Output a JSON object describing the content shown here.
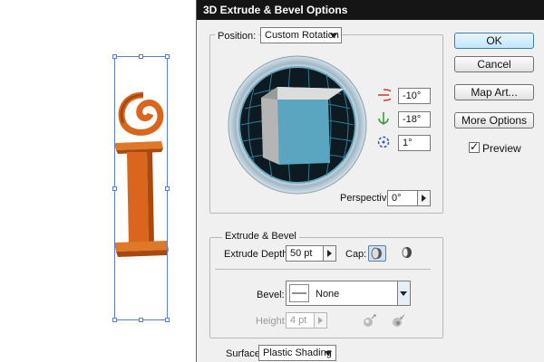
{
  "dialog": {
    "title": "3D Extrude & Bevel Options"
  },
  "position": {
    "label": "Position:",
    "preset": "Custom Rotation",
    "x_rotation": "-10°",
    "y_rotation": "-18°",
    "z_rotation": "1°",
    "perspective_label": "Perspective:",
    "perspective_value": "0°"
  },
  "buttons": {
    "ok": "OK",
    "cancel": "Cancel",
    "map_art": "Map Art...",
    "more_options": "More Options"
  },
  "preview": {
    "label": "Preview",
    "checked": true
  },
  "extrude": {
    "section_label": "Extrude & Bevel",
    "depth_label": "Extrude Depth:",
    "depth_value": "50 pt",
    "cap_label": "Cap:",
    "bevel_label": "Bevel:",
    "bevel_value": "None",
    "height_label": "Height:",
    "height_value": "4 pt"
  },
  "surface": {
    "label": "Surface:",
    "value": "Plastic Shading"
  },
  "colors": {
    "cube_front": "#5aa5bf",
    "art_orange": "#d9661c",
    "selection": "#5a7fc8",
    "titlebar": "#151515"
  },
  "icons": {
    "x_axis": "x-rotation-icon",
    "y_axis": "y-rotation-icon",
    "z_axis": "z-rotation-icon",
    "cap_on": "cap-on-icon",
    "cap_off": "cap-off-icon",
    "bevel_out": "bevel-out-icon",
    "bevel_in": "bevel-in-icon"
  }
}
